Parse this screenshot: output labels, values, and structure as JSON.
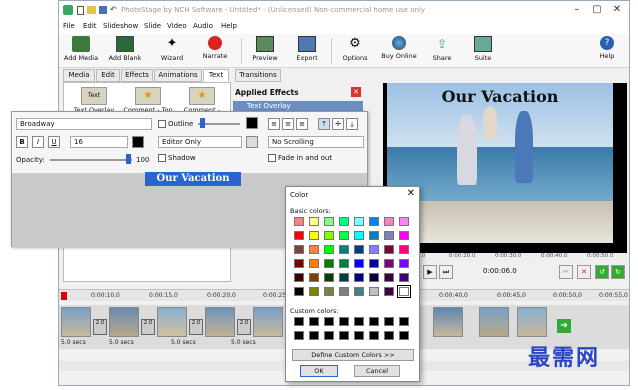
{
  "window": {
    "title": "PhotoStage by NCH Software - Untitled* - (Unlicensed) Non-commercial home use only"
  },
  "menu": [
    "File",
    "Edit",
    "Slideshow",
    "Slide",
    "Video",
    "Audio",
    "Help"
  ],
  "toolbar": {
    "add_media": "Add Media",
    "add_blank": "Add Blank",
    "wizard": "Wizard",
    "narrate": "Narrate",
    "preview": "Preview",
    "export": "Export",
    "options": "Options",
    "buy_online": "Buy Online",
    "share": "Share",
    "suite": "Suite",
    "help": "Help"
  },
  "tabs": [
    "Media",
    "Edit",
    "Effects",
    "Animations",
    "Text",
    "Transitions"
  ],
  "effects": [
    "Text Overlay",
    "Comment - Top",
    "Comment -"
  ],
  "applied": {
    "heading": "Applied Effects",
    "item": "Text Overlay"
  },
  "text_editor": {
    "font": "Broadway",
    "bold": "B",
    "italic": "I",
    "underline": "U",
    "size": "16",
    "outline": "Outline",
    "mode": "Editor Only",
    "shadow": "Shadow",
    "opacity_label": "Opacity:",
    "opacity_value": "100",
    "scrolling": "No Scrolling",
    "fade": "Fade in and out",
    "text": "Our Vacation"
  },
  "preview": {
    "caption": "Our Vacation",
    "time": "0:00:06.0",
    "ticks": [
      "0:00:10.0",
      "0:00:20.0",
      "0:00:30.0",
      "0:00:40.0",
      "0:00:50.0"
    ]
  },
  "timeline": {
    "ruler": [
      "0:00:10,0",
      "0:00:15,0",
      "0:00:20,0",
      "0:00:25,0",
      "0:00:40,0",
      "0:00:45,0",
      "0:00:50,0",
      "0:00:55,0"
    ],
    "clips": [
      {
        "dur": "5.0 secs"
      },
      {
        "dur": "5.0 secs"
      },
      {
        "dur": "5.0 secs"
      },
      {
        "dur": "5.0 secs"
      }
    ],
    "transition": "2.0"
  },
  "color_dialog": {
    "title": "Color",
    "basic_label": "Basic colors:",
    "custom_label": "Custom colors:",
    "define_button": "Define Custom Colors >>",
    "ok": "OK",
    "cancel": "Cancel",
    "basic_colors": [
      "#ff8080",
      "#ffff80",
      "#80ff80",
      "#00ff80",
      "#80ffff",
      "#0080ff",
      "#ff80c0",
      "#ff80ff",
      "#ff0000",
      "#ffff00",
      "#80ff00",
      "#00ff40",
      "#00ffff",
      "#0080c0",
      "#8080c0",
      "#ff00ff",
      "#804040",
      "#ff8040",
      "#00ff00",
      "#008080",
      "#004080",
      "#8080ff",
      "#800040",
      "#ff0080",
      "#800000",
      "#ff8000",
      "#008000",
      "#008040",
      "#0000ff",
      "#0000a0",
      "#800080",
      "#8000ff",
      "#400000",
      "#804000",
      "#004000",
      "#004040",
      "#000080",
      "#000040",
      "#400040",
      "#400080",
      "#000000",
      "#808000",
      "#808040",
      "#808080",
      "#408080",
      "#c0c0c0",
      "#400040",
      "#ffffff"
    ]
  },
  "watermark": "最需网"
}
